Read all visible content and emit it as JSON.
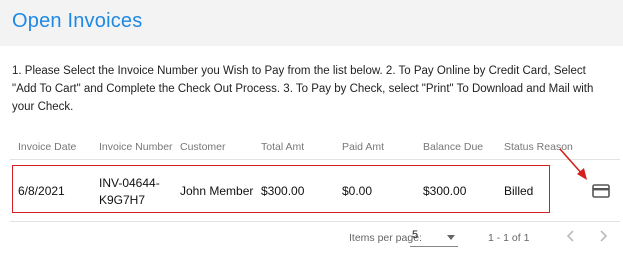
{
  "page": {
    "title": "Open Invoices",
    "instructions": "1. Please Select the Invoice Number you Wish to Pay from the list below. 2. To Pay Online by Credit Card, Select \"Add To Cart\" and Complete the Check Out Process. 3. To Pay by Check, select \"Print\" To Download and Mail with your Check."
  },
  "table": {
    "columns": [
      "Invoice Date",
      "Invoice Number",
      "Customer",
      "Total Amt",
      "Paid Amt",
      "Balance Due",
      "Status Reason"
    ],
    "rows": [
      {
        "invoice_date": "6/8/2021",
        "invoice_number_line1": "INV-04644-",
        "invoice_number_line2": "K9G7H7",
        "customer": "John Member",
        "total_amt": "$300.00",
        "paid_amt": "$0.00",
        "balance_due": "$300.00",
        "status_reason": "Billed",
        "action_icon": "credit-card-icon"
      }
    ]
  },
  "paginator": {
    "items_per_page_label": "Items per page:",
    "items_per_page_value": "5",
    "range_label": "1 - 1 of 1",
    "prev_icon": "chevron-left-icon",
    "next_icon": "chevron-right-icon"
  },
  "annotations": {
    "highlight_color": "#d42020",
    "arrow_icon": "red-arrow-icon"
  },
  "colors": {
    "title": "#1e88e5",
    "header_band": "#f3f3f3"
  }
}
